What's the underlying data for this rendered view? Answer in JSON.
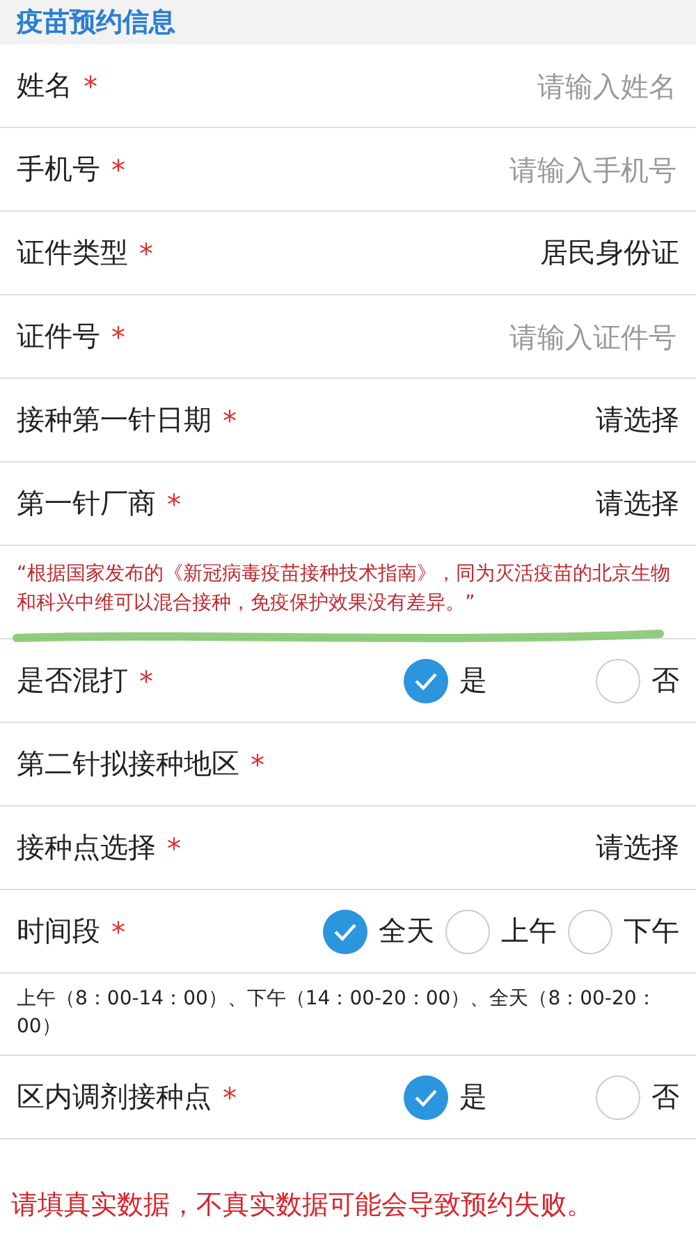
{
  "header": {
    "title": "疫苗预约信息"
  },
  "sections": [
    {
      "kind": "field",
      "label": "姓名",
      "required_mark": "*",
      "placeholder": "请输入姓名"
    },
    {
      "kind": "field",
      "label": "手机号",
      "required_mark": "*",
      "placeholder": "请输入手机号"
    },
    {
      "kind": "select",
      "label": "证件类型",
      "required_mark": "*",
      "value": "居民身份证"
    },
    {
      "kind": "field",
      "label": "证件号",
      "required_mark": "*",
      "placeholder": "请输入证件号"
    },
    {
      "kind": "select",
      "label": "接种第一针日期",
      "required_mark": "*",
      "value": "请选择"
    },
    {
      "kind": "select",
      "label": "第一针厂商",
      "required_mark": "*",
      "value": "请选择"
    },
    {
      "kind": "note",
      "text": "“根据国家发布的《新冠病毒疫苗接种技术指南》，同为灭活疫苗的北京生物和科兴中维可以混合接种，免疫保护效果没有差异。”",
      "highlighted": true
    },
    {
      "kind": "radio",
      "label": "是否混打",
      "required_mark": "*",
      "options": [
        {
          "label": "是",
          "selected": true
        },
        {
          "label": "否",
          "selected": false
        }
      ]
    },
    {
      "kind": "select",
      "label": "第二针拟接种地区",
      "required_mark": "*"
    },
    {
      "kind": "select",
      "label": "接种点选择",
      "required_mark": "*",
      "value": "请选择"
    },
    {
      "kind": "radio",
      "label": "时间段",
      "required_mark": "*",
      "options": [
        {
          "label": "全天",
          "selected": true
        },
        {
          "label": "上午",
          "selected": false
        },
        {
          "label": "下午",
          "selected": false
        }
      ]
    },
    {
      "kind": "hint",
      "text": "上午（8：00-14：00）、下午（14：00-20：00）、全天（8：00-20：00）"
    },
    {
      "kind": "radio",
      "label": "区内调剂接种点",
      "required_mark": "*",
      "options": [
        {
          "label": "是",
          "selected": true
        },
        {
          "label": "否",
          "selected": false
        }
      ]
    }
  ],
  "footer": {
    "warning": "请填真实数据，不真实数据可能会导致预约失败。"
  }
}
